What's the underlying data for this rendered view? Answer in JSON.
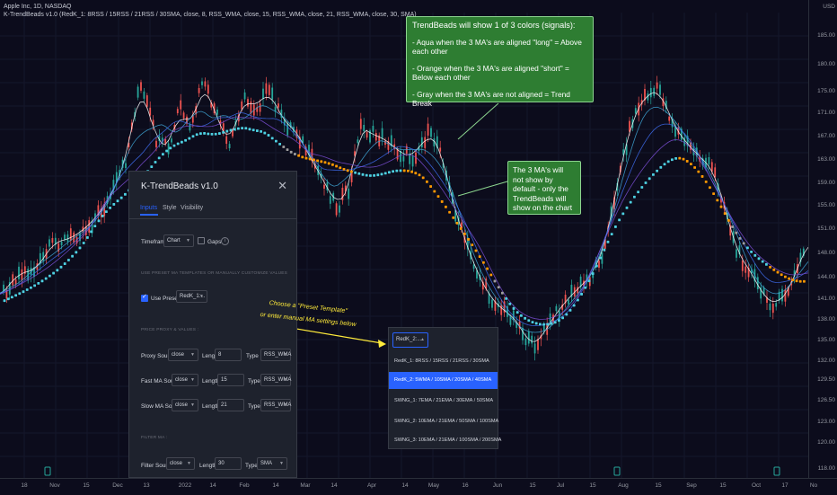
{
  "header": {
    "line1": "Apple Inc, 1D, NASDAQ",
    "line2": "K-TrendBeads v1.0 (RedK_1: 8RSS / 15RSS / 21RSS / 30SMA, close, 8, RSS_WMA, close, 15, RSS_WMA, close, 21, RSS_WMA, close, 30, SMA)"
  },
  "price_axis": {
    "currency": "USD",
    "ticks": [
      "185.00",
      "180.00",
      "175.00",
      "171.00",
      "167.00",
      "163.00",
      "159.00",
      "155.00",
      "151.00",
      "148.00",
      "144.00",
      "141.00",
      "138.00",
      "135.00",
      "132.00",
      "129.50",
      "126.50",
      "123.00",
      "120.00",
      "118.00"
    ]
  },
  "time_axis": {
    "ticks": [
      "18",
      "Nov",
      "15",
      "Dec",
      "13",
      "2022",
      "14",
      "Feb",
      "14",
      "Mar",
      "14",
      "Apr",
      "14",
      "May",
      "16",
      "Jun",
      "15",
      "Jul",
      "15",
      "Aug",
      "15",
      "Sep",
      "15",
      "Oct",
      "17",
      "No"
    ]
  },
  "colors": {
    "aqua": "#4dd0e1",
    "orange": "#ff9800",
    "gray": "#9e9e9e",
    "ma_white": "#ffffff",
    "ma_blue": "#3f6ff2",
    "ma_cyan": "#40a8d8",
    "ma_purple": "#7b4fd6",
    "candle_up": "#26a69a",
    "candle_down": "#ef5350",
    "callout_bg": "#2e7d32",
    "accent": "#2962ff",
    "annotation": "#ffeb3b"
  },
  "callout_top": {
    "title": "TrendBeads will show 1 of 3 colors (signals):",
    "lines": [
      "- Aqua when the 3 MA's are aligned \"long\" = Above each other",
      "- Orange when the 3 MA's are aligned \"short\" = Below each other",
      "- Gray when the 3 MA's are not aligned = Trend Break"
    ]
  },
  "callout_mid": {
    "text": "The 3 MA's will not show by default - only the TrendBeads will show on the chart"
  },
  "panel": {
    "title": "K-TrendBeads v1.0",
    "close_icon": "close-icon",
    "tabs": [
      "Inputs",
      "Style",
      "Visibility"
    ],
    "timeframe": {
      "label": "Timeframe",
      "value": "Chart",
      "gaps_label": "Gaps"
    },
    "section_presets": "USE PRESET MA TEMPLATES OR MANUALLY CUSTOMIZE VALUES",
    "use_presets": {
      "label": "Use Presets?",
      "value": "RedK_1:..."
    },
    "section_price": "PRICE PROXY & VALUES :",
    "rows": [
      {
        "label": "Proxy Source",
        "source": "close",
        "length": "8",
        "type": "RSS_WMA"
      },
      {
        "label": "Fast MA Source",
        "source": "close",
        "length": "15",
        "type": "RSS_WMA"
      },
      {
        "label": "Slow MA Source",
        "source": "close",
        "length": "21",
        "type": "RSS_WMA"
      }
    ],
    "section_filter": "FILTER MA :",
    "filter_row": {
      "label": "Filter Source",
      "source": "close",
      "length": "30",
      "type": "SMA"
    },
    "length_label": "Length",
    "type_label": "Type"
  },
  "annotation": {
    "line1": "Choose a \"Preset Template\"",
    "line2": "or enter manual MA settings below"
  },
  "dropdown": {
    "selected": "RedK_2:...",
    "options": [
      "RedK_1: 8RSS / 15RSS / 21RSS / 30SMA",
      "RedK_2: 5WMA / 10SMA / 20SMA / 40SMA",
      "SWNG_1: 7EMA / 21EMA / 30EMA / 50SMA",
      "SWNG_2: 10EMA / 21EMA / 50SMA / 100SMA",
      "SWNG_3: 10EMA / 21EMA / 100SMA / 200SMA"
    ],
    "highlighted_index": 1
  }
}
